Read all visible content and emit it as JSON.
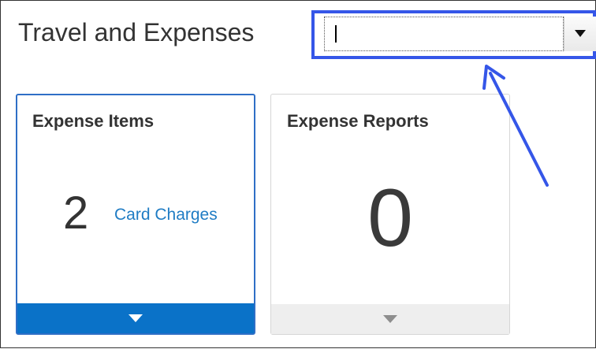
{
  "page": {
    "title": "Travel and Expenses"
  },
  "search": {
    "value": "",
    "placeholder": ""
  },
  "tiles": [
    {
      "title": "Expense Items",
      "count": "2",
      "count_label": "Card Charges",
      "footer_color": "#0a72c8"
    },
    {
      "title": "Expense Reports",
      "count": "0",
      "footer_color": "#eeeeee"
    }
  ],
  "annotation": {
    "color": "#3556e8",
    "icon": "arrow-pointer-icon"
  }
}
